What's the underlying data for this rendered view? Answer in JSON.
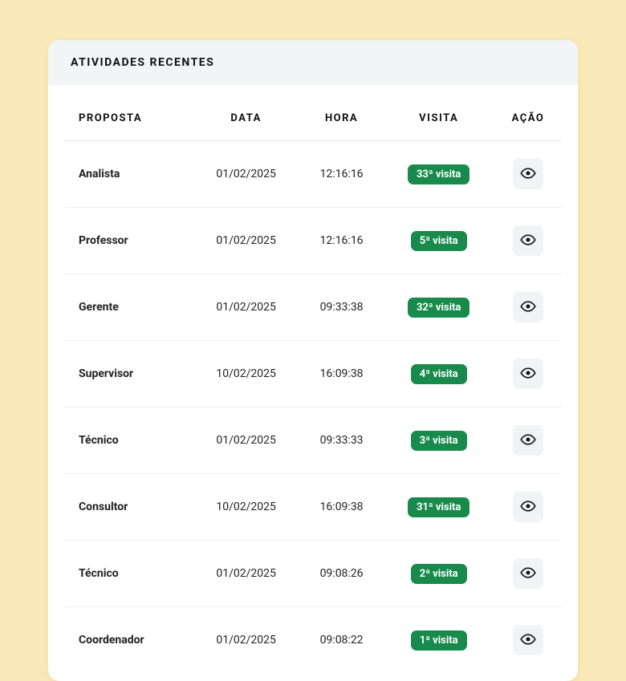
{
  "header": {
    "title": "ATIVIDADES RECENTES"
  },
  "table": {
    "columns": {
      "proposta": "PROPOSTA",
      "data": "DATA",
      "hora": "HORA",
      "visita": "VISITA",
      "acao": "AÇÃO"
    },
    "rows": [
      {
        "proposta": "Analista",
        "data": "01/02/2025",
        "hora": "12:16:16",
        "visita": "33ª visita"
      },
      {
        "proposta": "Professor",
        "data": "01/02/2025",
        "hora": "12:16:16",
        "visita": "5ª visita"
      },
      {
        "proposta": "Gerente",
        "data": "01/02/2025",
        "hora": "09:33:38",
        "visita": "32ª visita"
      },
      {
        "proposta": "Supervisor",
        "data": "10/02/2025",
        "hora": "16:09:38",
        "visita": "4ª visita"
      },
      {
        "proposta": "Técnico",
        "data": "01/02/2025",
        "hora": "09:33:33",
        "visita": "3ª visita"
      },
      {
        "proposta": "Consultor",
        "data": "10/02/2025",
        "hora": "16:09:38",
        "visita": "31ª visita"
      },
      {
        "proposta": "Técnico",
        "data": "01/02/2025",
        "hora": "09:08:26",
        "visita": "2ª visita"
      },
      {
        "proposta": "Coordenador",
        "data": "01/02/2025",
        "hora": "09:08:22",
        "visita": "1ª visita"
      }
    ]
  },
  "icons": {
    "eye": "eye-icon"
  }
}
